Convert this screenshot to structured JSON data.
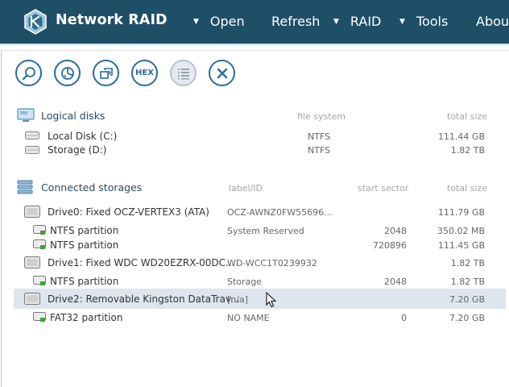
{
  "app": {
    "title": "Network RAID"
  },
  "menu": {
    "items": [
      {
        "label": "Open",
        "has_dropdown": true
      },
      {
        "label": "Refresh",
        "has_dropdown": false
      },
      {
        "label": "RAID",
        "has_dropdown": true
      },
      {
        "label": "Tools",
        "has_dropdown": true
      },
      {
        "label": "About",
        "has_dropdown": false
      }
    ],
    "dropdown_glyph": "▼"
  },
  "toolbar": {
    "buttons": [
      {
        "name": "search-icon"
      },
      {
        "name": "chart-icon"
      },
      {
        "name": "compare-icon"
      },
      {
        "name": "hex-button",
        "label": "HEX"
      },
      {
        "name": "list-icon"
      },
      {
        "name": "close-icon"
      }
    ]
  },
  "logical_disks": {
    "title": "Logical disks",
    "columns": {
      "file_system": "file system",
      "total_size": "total size"
    },
    "rows": [
      {
        "name": "Local Disk (C:)",
        "file_system": "NTFS",
        "total_size": "111.44 GB"
      },
      {
        "name": "Storage (D:)",
        "file_system": "NTFS",
        "total_size": "1.82 TB"
      }
    ]
  },
  "connected_storages": {
    "title": "Connected storages",
    "columns": {
      "label": "label/ID",
      "start_sector": "start sector",
      "total_size": "total size"
    },
    "rows": [
      {
        "kind": "drive",
        "name": "Drive0: Fixed OCZ-VERTEX3 (ATA)",
        "label": "OCZ-AWNZ0FW55696...",
        "start_sector": "",
        "total_size": "111.79 GB"
      },
      {
        "kind": "partition",
        "name": "NTFS partition",
        "label": "System Reserved",
        "start_sector": "2048",
        "total_size": "350.02 MB"
      },
      {
        "kind": "partition",
        "name": "NTFS partition",
        "label": "",
        "start_sector": "720896",
        "total_size": "111.45 GB"
      },
      {
        "kind": "drive",
        "name": "Drive1: Fixed WDC WD20EZRX-00DC...",
        "label": "WD-WCC1T0239932",
        "start_sector": "",
        "total_size": "1.82 TB"
      },
      {
        "kind": "partition",
        "name": "NTFS partition",
        "label": "Storage",
        "start_sector": "2048",
        "total_size": "1.82 TB"
      },
      {
        "kind": "drive",
        "name": "Drive2: Removable Kingston DataTrav...",
        "label": "[n/a]",
        "start_sector": "",
        "total_size": "7.20 GB",
        "selected": true
      },
      {
        "kind": "partition",
        "name": "FAT32 partition",
        "label": "NO NAME",
        "start_sector": "0",
        "total_size": "7.20 GB"
      }
    ]
  },
  "colors": {
    "titlebar": "#1f4e67",
    "accent": "#2a6c99",
    "selected_row": "#dde6ef",
    "partition_green": "#3aa33a"
  }
}
